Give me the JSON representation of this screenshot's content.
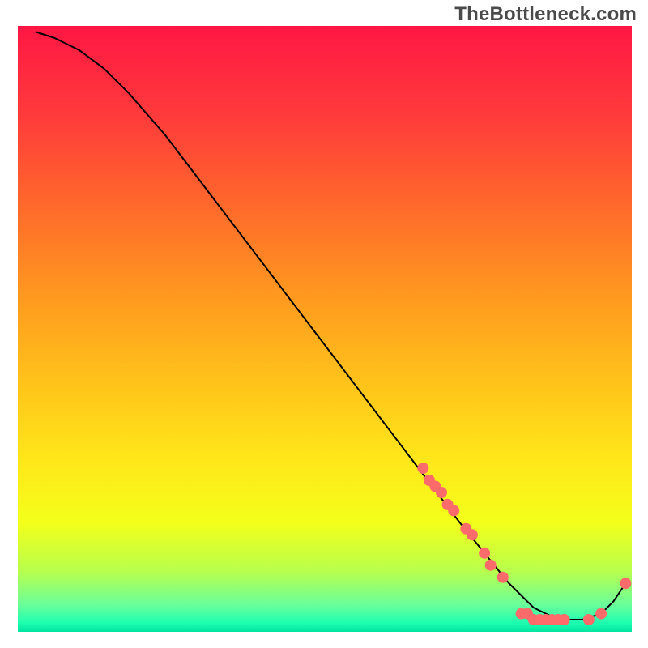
{
  "watermark": "TheBottleneck.com",
  "chart_data": {
    "type": "line",
    "title": "",
    "xlabel": "",
    "ylabel": "",
    "xlim": [
      0,
      100
    ],
    "ylim": [
      0,
      100
    ],
    "grid": false,
    "legend": false,
    "gradient_stops": [
      {
        "offset": 0.0,
        "color": "#ff1744"
      },
      {
        "offset": 0.15,
        "color": "#ff3b3b"
      },
      {
        "offset": 0.3,
        "color": "#ff6a2b"
      },
      {
        "offset": 0.45,
        "color": "#ff9a1f"
      },
      {
        "offset": 0.6,
        "color": "#ffc61a"
      },
      {
        "offset": 0.72,
        "color": "#ffe81a"
      },
      {
        "offset": 0.82,
        "color": "#f3ff1a"
      },
      {
        "offset": 0.9,
        "color": "#b8ff4d"
      },
      {
        "offset": 0.955,
        "color": "#6bff9a"
      },
      {
        "offset": 0.985,
        "color": "#1effb0"
      },
      {
        "offset": 1.0,
        "color": "#00e4a0"
      }
    ],
    "series": [
      {
        "name": "bottleneck-curve",
        "color": "#000000",
        "stroke_width": 2,
        "x": [
          3,
          6,
          10,
          14,
          18,
          24,
          30,
          36,
          42,
          48,
          54,
          60,
          66,
          72,
          76,
          80,
          84,
          88,
          92,
          95,
          97,
          99
        ],
        "y": [
          99,
          98,
          96,
          93,
          89,
          82,
          74,
          66,
          58,
          50,
          42,
          34,
          26,
          18,
          13,
          8,
          4,
          2,
          2,
          3,
          5,
          8
        ]
      }
    ],
    "scatter": [
      {
        "name": "highlight-points",
        "color": "#ff6b6b",
        "radius": 7,
        "points": [
          {
            "x": 66,
            "y": 27
          },
          {
            "x": 67,
            "y": 25
          },
          {
            "x": 68,
            "y": 24
          },
          {
            "x": 69,
            "y": 23
          },
          {
            "x": 70,
            "y": 21
          },
          {
            "x": 71,
            "y": 20
          },
          {
            "x": 73,
            "y": 17
          },
          {
            "x": 74,
            "y": 16
          },
          {
            "x": 76,
            "y": 13
          },
          {
            "x": 77,
            "y": 11
          },
          {
            "x": 79,
            "y": 9
          },
          {
            "x": 82,
            "y": 3
          },
          {
            "x": 83,
            "y": 3
          },
          {
            "x": 84,
            "y": 2
          },
          {
            "x": 85,
            "y": 2
          },
          {
            "x": 86,
            "y": 2
          },
          {
            "x": 87,
            "y": 2
          },
          {
            "x": 88,
            "y": 2
          },
          {
            "x": 89,
            "y": 2
          },
          {
            "x": 93,
            "y": 2
          },
          {
            "x": 95,
            "y": 3
          },
          {
            "x": 99,
            "y": 8
          }
        ]
      }
    ]
  }
}
